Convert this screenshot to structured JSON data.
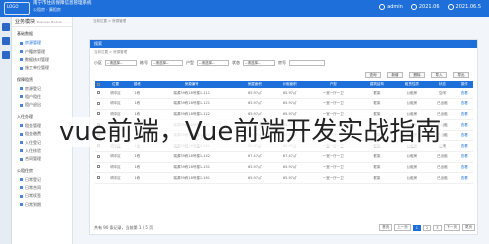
{
  "header": {
    "logo_text": "LOGO",
    "brand_line1": "南宁市住房保障信息管理系统",
    "brand_line2": "公租房 · 廉租房",
    "user": "admin",
    "date1": "2021.06",
    "date2": "2021.06.5"
  },
  "sidebar": {
    "title": "业务模块",
    "subtitle": "Business Module",
    "groups": [
      {
        "title": "基础数据",
        "items": [
          "房源管理",
          "户籍房管理",
          "数据核对管理",
          "施工单位管理"
        ]
      },
      {
        "title": "保障租赁",
        "items": [
          "房源登记",
          "租户租住",
          "租户退出"
        ]
      },
      {
        "title": "入住办理",
        "items": [
          "租金管理",
          "租金缴费",
          "入住登记",
          "入住核验",
          "合同管理"
        ]
      },
      {
        "title": "公租住房",
        "items": [
          "日常登记",
          "日常合同",
          "日常续签",
          "日常到期"
        ]
      }
    ]
  },
  "main": {
    "breadcrumb": "当前位置 > 房源管理",
    "panel_title": "搜索",
    "panel_crumb": "当前位置 > 房源管理",
    "filters": {
      "district_label": "小区",
      "building_label": "栋号",
      "type_label": "户型",
      "status_label": "状态",
      "room_label": "房号",
      "select_placeholder": "--请选择--"
    },
    "buttons": [
      "查询",
      "新增",
      "删除",
      "导入",
      "导出"
    ],
    "table": {
      "headers": [
        "",
        "位置",
        "楼栋",
        "房源编号",
        "房屋面积",
        "计租面积",
        "户型",
        "建筑结构",
        "租赁性质",
        "状态",
        "操作"
      ],
      "rows": [
        [
          "",
          "明中区",
          "1栋",
          "瑞源39栋18号楼1-111",
          "65.97㎡",
          "65.97㎡",
          "一室一厅一卫",
          "框架",
          "公租房",
          "空闲",
          "查看"
        ],
        [
          "",
          "明中区",
          "1栋",
          "瑞源39栋18号楼1-121",
          "65.97㎡",
          "65.97㎡",
          "一室一厅一卫",
          "框架",
          "公租房",
          "已出租",
          "查看"
        ],
        [
          "",
          "明中区",
          "1栋",
          "瑞源39栋18号楼1-122",
          "65.97㎡",
          "65.97㎡",
          "一室一厅一卫",
          "框架",
          "公租房",
          "已出租",
          "查看"
        ],
        [
          "",
          "明中区",
          "1栋",
          "瑞源39栋18号楼1-131",
          "65.97㎡",
          "65.97㎡",
          "一室一厅一卫",
          "框架",
          "公租房",
          "已出租",
          "查看"
        ],
        [
          "",
          "明中区",
          "1栋",
          "瑞源39栋18号楼1-132",
          "67.47㎡",
          "67.47㎡",
          "一室一厅一卫",
          "框架",
          "公租房",
          "已出租",
          "查看"
        ],
        [
          "",
          "明中区",
          "1栋",
          "瑞源39栋18号楼1-141",
          "65.97㎡",
          "65.97㎡",
          "一室一厅一卫",
          "框架",
          "公租房",
          "空闲",
          "查看"
        ],
        [
          "",
          "明中区",
          "1栋",
          "瑞源39栋18号楼1-142",
          "67.47㎡",
          "67.47㎡",
          "一室一厅一卫",
          "框架",
          "公租房",
          "已出租",
          "查看"
        ],
        [
          "",
          "明中区",
          "1栋",
          "瑞源39栋18号楼1-151",
          "65.97㎡",
          "65.97㎡",
          "一室一厅一卫",
          "框架",
          "公租房",
          "已出租",
          "查看"
        ],
        [
          "",
          "明中区",
          "1栋",
          "瑞源39栋18号楼1-161",
          "65.97㎡",
          "65.97㎡",
          "一室一厅一卫",
          "框架",
          "公租房",
          "已出租",
          "查看"
        ]
      ]
    },
    "pager": {
      "summary": "共有 90 条记录，当前第 1 / 5 页",
      "pages": [
        "首页",
        "上一页",
        "1",
        "2",
        "3",
        "下一页",
        "尾页"
      ]
    }
  },
  "overlay_text": "vue前端，Vue前端开发实战指南",
  "colors": {
    "primary": "#1e6fd9"
  }
}
